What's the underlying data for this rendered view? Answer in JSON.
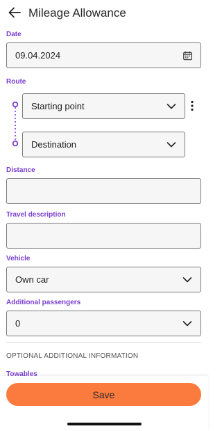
{
  "header": {
    "title": "Mileage Allowance",
    "back_icon": "arrow-left-icon"
  },
  "date": {
    "label": "Date",
    "value": "09.04.2024",
    "icon": "calendar-icon"
  },
  "route": {
    "label": "Route",
    "start": "Starting point",
    "destination": "Destination",
    "more_icon": "more-vertical-icon"
  },
  "distance": {
    "label": "Distance",
    "value": ""
  },
  "travel_description": {
    "label": "Travel description",
    "value": ""
  },
  "vehicle": {
    "label": "Vehicle",
    "value": "Own car"
  },
  "passengers": {
    "label": "Additional passengers",
    "value": "0"
  },
  "optional": {
    "heading": "OPTIONAL ADDITIONAL INFORMATION",
    "next_label": "Towables"
  },
  "actions": {
    "save": "Save"
  },
  "colors": {
    "accent": "#7a3fd1",
    "primary_button": "#fb7a3e"
  }
}
